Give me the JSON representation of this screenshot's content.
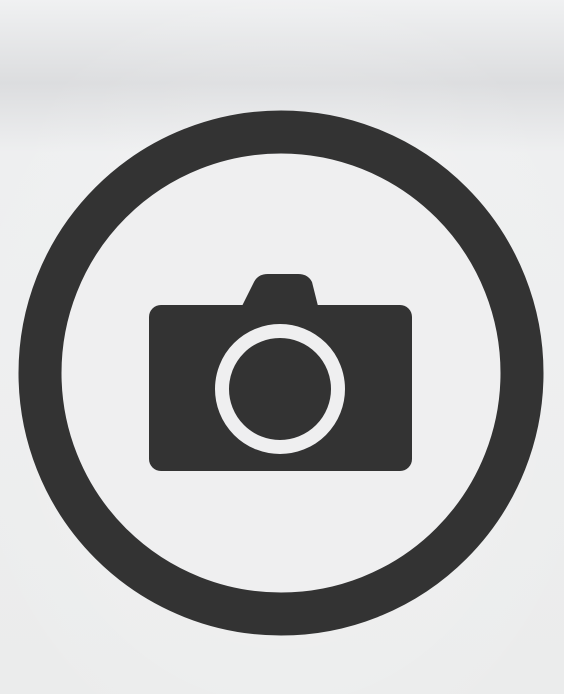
{
  "camera_button": {
    "icon": "camera-icon",
    "ring_icon": "circle-outline-icon"
  },
  "colors": {
    "icon": "#333333",
    "background": "#e9eaeb",
    "inner_fill": "#efeff0"
  }
}
